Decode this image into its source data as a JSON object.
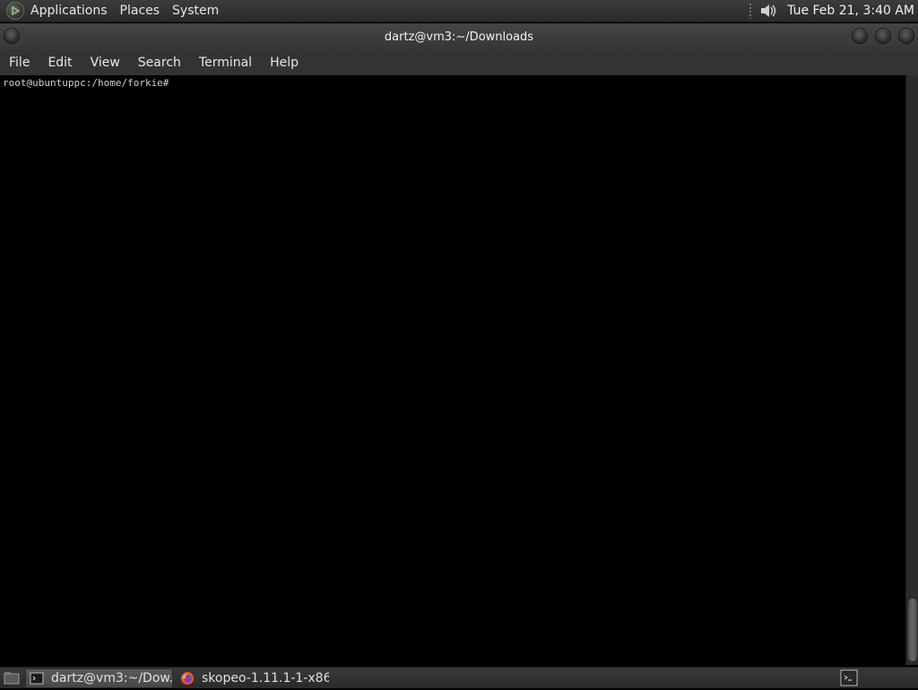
{
  "top_panel": {
    "menus": [
      "Applications",
      "Places",
      "System"
    ],
    "clock": "Tue Feb 21,  3:40 AM"
  },
  "window": {
    "title": "dartz@vm3:~/Downloads",
    "menubar": [
      "File",
      "Edit",
      "View",
      "Search",
      "Terminal",
      "Help"
    ]
  },
  "terminal": {
    "prompt": "root@ubuntuppc:/home/forkie#"
  },
  "taskbar": {
    "tasks": [
      {
        "label": "dartz@vm3:~/Dow...",
        "icon": "terminal-icon",
        "active": true
      },
      {
        "label": "skopeo-1.11.1-1-x86...",
        "icon": "firefox-icon",
        "active": false
      }
    ]
  },
  "colors": {
    "panel": "#2f2f2f",
    "terminal_bg": "#000000",
    "text": "#e6e6e6",
    "logo_accent": "#7a9a5a"
  }
}
